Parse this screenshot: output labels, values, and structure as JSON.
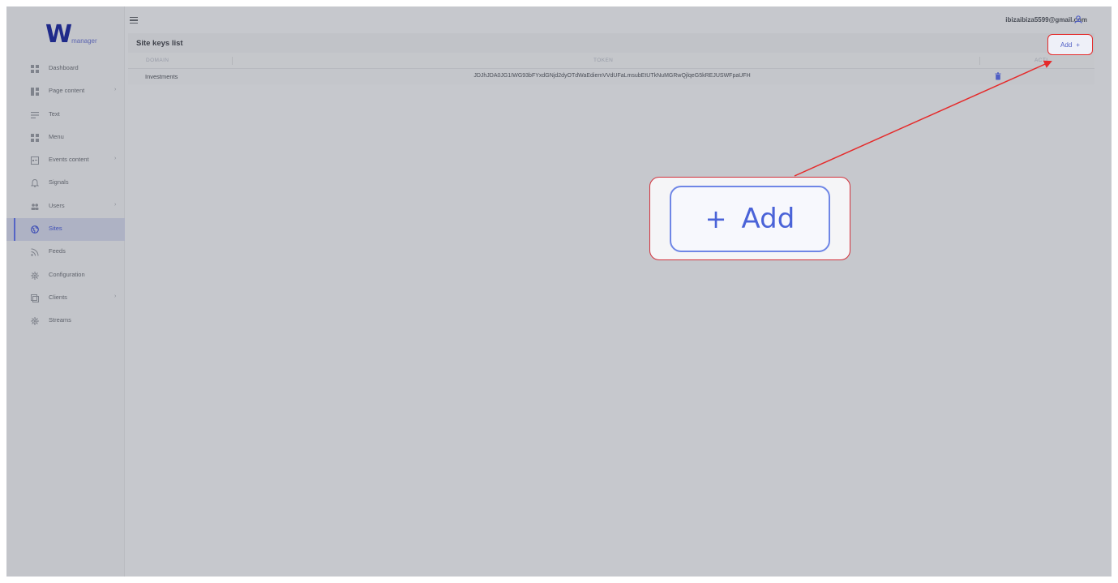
{
  "app": {
    "logo_letter": "W",
    "logo_sub": "manager",
    "user_email": "ibizaibiza5599@gmail.com"
  },
  "sidebar": {
    "items": [
      {
        "label": "Dashboard",
        "icon": "dashboard-icon",
        "chevron": ""
      },
      {
        "label": "Page content",
        "icon": "page-content-icon",
        "chevron": "›"
      },
      {
        "label": "Text",
        "icon": "text-icon",
        "chevron": ""
      },
      {
        "label": "Menu",
        "icon": "menu-grid-icon",
        "chevron": ""
      },
      {
        "label": "Events content",
        "icon": "events-icon",
        "chevron": "›"
      },
      {
        "label": "Signals",
        "icon": "bell-icon",
        "chevron": ""
      },
      {
        "label": "Users",
        "icon": "users-icon",
        "chevron": "›"
      },
      {
        "label": "Sites",
        "icon": "globe-icon",
        "chevron": "",
        "active": true
      },
      {
        "label": "Feeds",
        "icon": "rss-icon",
        "chevron": ""
      },
      {
        "label": "Configuration",
        "icon": "gear-icon",
        "chevron": ""
      },
      {
        "label": "Clients",
        "icon": "clients-icon",
        "chevron": "›"
      },
      {
        "label": "Streams",
        "icon": "gear-icon",
        "chevron": ""
      }
    ]
  },
  "main": {
    "title": "Site keys list",
    "add_label": "Add",
    "add_icon": "+",
    "table": {
      "headers": [
        "DOMAIN",
        "TOKEN",
        "ACTI"
      ],
      "rows": [
        {
          "domain": "Investments",
          "token": "JDJhJDA0JG1IWG93bFYxdGNjd2dyOTdWaEdiemVVdUFaLmsubEtUTkNuMGRwQjlqeG5kREJUSWFpaUFH"
        }
      ]
    }
  },
  "annotation": {
    "zoom_plus": "+",
    "zoom_label": "Add",
    "highlight_color": "#e52a2a"
  },
  "colors": {
    "accent": "#4f5ec5",
    "sidebar_active": "#aeb2c4"
  }
}
